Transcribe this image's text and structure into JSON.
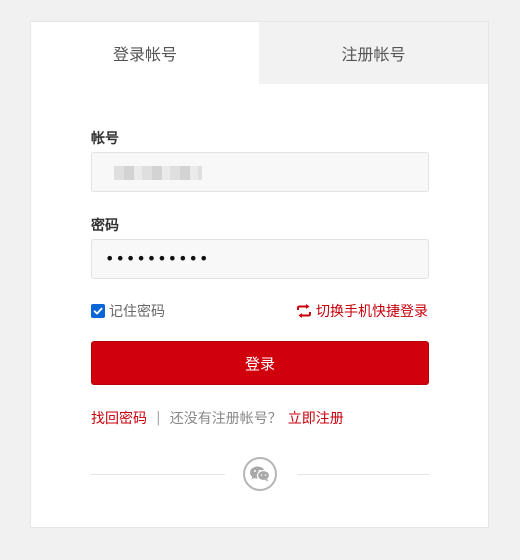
{
  "tabs": {
    "login": "登录帐号",
    "register": "注册帐号"
  },
  "form": {
    "username_label": "帐号",
    "password_label": "密码",
    "password_value": "••••••••••",
    "remember_label": "记住密码",
    "remember_checked": true,
    "switch_mobile": "切换手机快捷登录",
    "login_button": "登录"
  },
  "links": {
    "recover": "找回密码",
    "separator": "|",
    "no_account": "还没有注册帐号？",
    "register_now": "立即注册"
  },
  "icons": {
    "switch": "refresh-icon",
    "social": "wechat-icon",
    "checkbox": "checkmark-icon"
  },
  "colors": {
    "accent": "#d0000c",
    "link": "#c9000b",
    "checkbox": "#0a66d6"
  }
}
